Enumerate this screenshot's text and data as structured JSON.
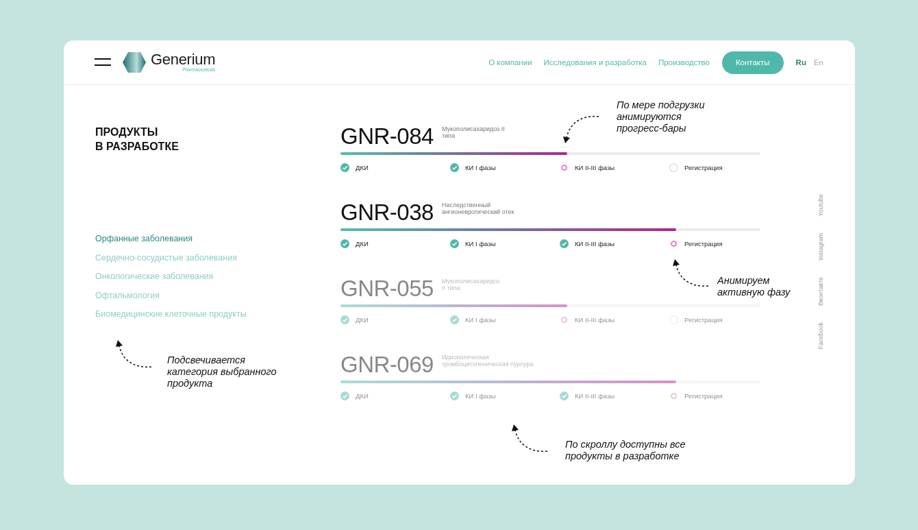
{
  "header": {
    "logo": {
      "name": "Generium",
      "tagline": "Pharmaceuticals"
    },
    "nav": [
      {
        "label": "О компании",
        "kind": "link"
      },
      {
        "label": "Исследования и разработка",
        "kind": "link"
      },
      {
        "label": "Производство",
        "kind": "link"
      },
      {
        "label": "Контакты",
        "kind": "button"
      }
    ],
    "languages": [
      {
        "label": "Ru",
        "selected": true
      },
      {
        "label": "En",
        "selected": false
      }
    ]
  },
  "heading": [
    "ПРОДУКТЫ",
    "В РАЗРАБОТКЕ"
  ],
  "categories": [
    {
      "label": "Орфанные заболевания",
      "selected": true
    },
    {
      "label": "Сердечно-сосудистые заболевания",
      "selected": false
    },
    {
      "label": "Онкологические заболевания",
      "selected": false
    },
    {
      "label": "Офтальмология",
      "selected": false
    },
    {
      "label": "Биомедицинские клеточные продукты",
      "selected": false
    }
  ],
  "products": [
    {
      "code": "GNR-084",
      "description": [
        "Мукополисахаридоз II",
        "типа"
      ],
      "dimmed": false,
      "level": 0.54,
      "phases": [
        {
          "label": "ДКИ",
          "done": true,
          "active": false
        },
        {
          "label": "КИ I фазы",
          "done": true,
          "active": false
        },
        {
          "label": "КИ II-III фазы",
          "done": false,
          "active": true
        },
        {
          "label": "Регистрация",
          "done": false,
          "active": false
        }
      ]
    },
    {
      "code": "GNR-038",
      "description": [
        "Наследственный",
        "ангионевротический отек"
      ],
      "dimmed": false,
      "level": 0.8,
      "phases": [
        {
          "label": "ДКИ",
          "done": true,
          "active": false
        },
        {
          "label": "КИ I фазы",
          "done": true,
          "active": false
        },
        {
          "label": "КИ II-III фазы",
          "done": true,
          "active": false
        },
        {
          "label": "Регистрация",
          "done": false,
          "active": true
        }
      ]
    },
    {
      "code": "GNR-055",
      "description": [
        "Мукополисахаридоз",
        "II типа"
      ],
      "dimmed": true,
      "level": 0.54,
      "phases": [
        {
          "label": "ДКИ",
          "done": true,
          "active": false
        },
        {
          "label": "КИ I фазы",
          "done": true,
          "active": false
        },
        {
          "label": "КИ II-III фазы",
          "done": false,
          "active": true
        },
        {
          "label": "Регистрация",
          "done": false,
          "active": false
        }
      ]
    },
    {
      "code": "GNR-069",
      "description": [
        "Идиопатическая",
        "тромбоцитопеническая пурпура"
      ],
      "dimmed": true,
      "level": 0.8,
      "phases": [
        {
          "label": "ДКИ",
          "done": true,
          "active": false
        },
        {
          "label": "КИ I фазы",
          "done": true,
          "active": false
        },
        {
          "label": "КИ II-III фазы",
          "done": true,
          "active": false
        },
        {
          "label": "Регистрация",
          "done": false,
          "active": true
        }
      ]
    }
  ],
  "social": [
    "Youtube",
    "Instagram",
    "Вконтакте",
    "Facebook"
  ],
  "annotations": [
    {
      "text": [
        "По мере подгрузки",
        "анимируются",
        "прогресс-бары"
      ],
      "arrow_up": false
    },
    {
      "text": [
        "Анимируем",
        "активную фазу"
      ],
      "arrow_up": true
    },
    {
      "text": [
        "Подсвечивается",
        "категория выбранного",
        "продукта"
      ],
      "arrow_up": true
    },
    {
      "text": [
        "По скроллу доступны все",
        "продукты в разработке"
      ],
      "arrow_up": true
    }
  ]
}
